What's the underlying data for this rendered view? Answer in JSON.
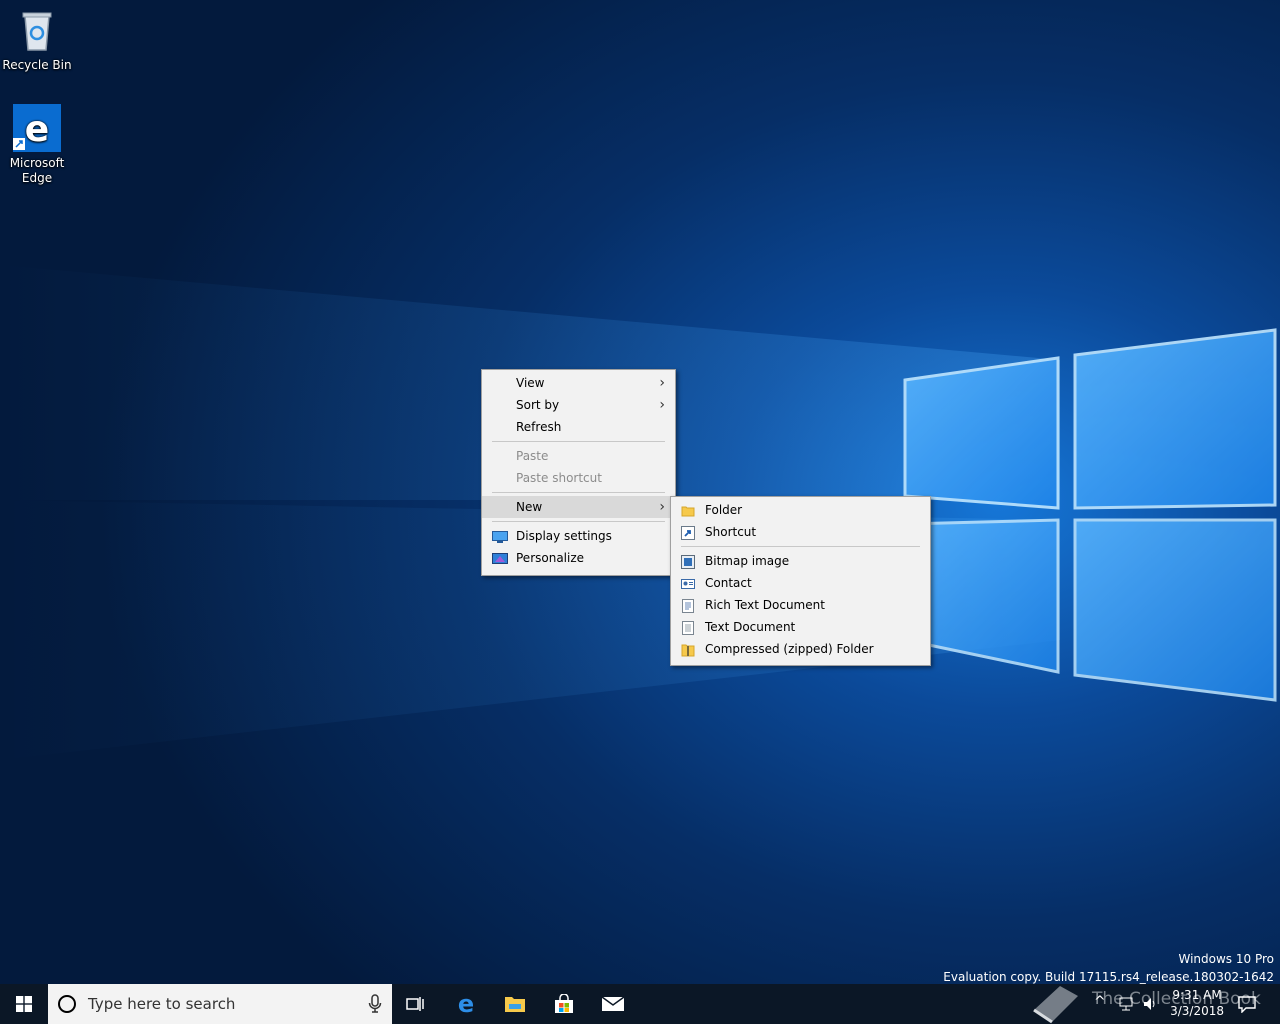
{
  "desktop": {
    "icons": [
      {
        "label": "Recycle Bin"
      },
      {
        "label": "Microsoft Edge"
      }
    ]
  },
  "context_menu": {
    "items": {
      "view": "View",
      "sort_by": "Sort by",
      "refresh": "Refresh",
      "paste": "Paste",
      "paste_shortcut": "Paste shortcut",
      "new": "New",
      "display_settings": "Display settings",
      "personalize": "Personalize"
    }
  },
  "new_submenu": {
    "items": {
      "folder": "Folder",
      "shortcut": "Shortcut",
      "bitmap": "Bitmap image",
      "contact": "Contact",
      "rtf": "Rich Text Document",
      "text": "Text Document",
      "zip": "Compressed (zipped) Folder"
    }
  },
  "watermark": {
    "edition": "Windows 10 Pro",
    "build": "Evaluation copy. Build 17115.rs4_release.180302-1642"
  },
  "taskbar": {
    "search_placeholder": "Type here to search",
    "clock_time": "9:31 AM",
    "clock_date": "3/3/2018",
    "overlay_text": "The Collection Book"
  },
  "colors": {
    "accent": "#0078d7",
    "taskbar": "#0b1726",
    "menu_bg": "#f2f2f2"
  }
}
